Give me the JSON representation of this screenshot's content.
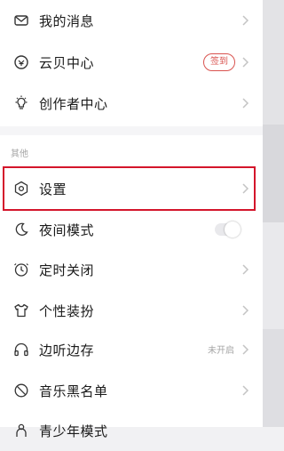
{
  "menu": {
    "top_items": [
      {
        "label": "我的消息",
        "icon": "mail-icon"
      },
      {
        "label": "云贝中心",
        "icon": "coin-icon",
        "badge": "签到"
      },
      {
        "label": "创作者中心",
        "icon": "bulb-icon"
      }
    ],
    "section_label": "其他",
    "other_items": [
      {
        "label": "设置",
        "icon": "gear-icon"
      },
      {
        "label": "夜间模式",
        "icon": "moon-icon",
        "toggle_on": false
      },
      {
        "label": "定时关闭",
        "icon": "clock-icon"
      },
      {
        "label": "个性装扮",
        "icon": "tshirt-icon"
      },
      {
        "label": "边听边存",
        "icon": "headphones-icon",
        "status": "未开启"
      },
      {
        "label": "音乐黑名单",
        "icon": "block-icon"
      },
      {
        "label": "青少年模式",
        "icon": "child-icon"
      }
    ]
  },
  "colors": {
    "highlight": "#d4152b",
    "badge": "#d9534f"
  }
}
